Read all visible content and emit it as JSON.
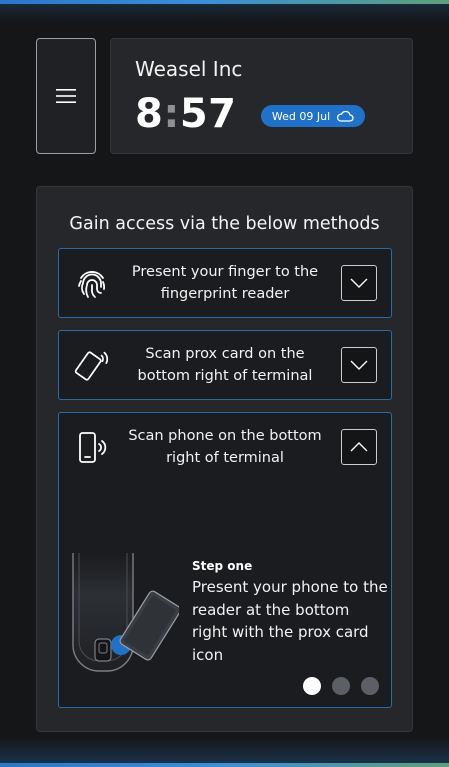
{
  "header": {
    "company_name": "Weasel Inc",
    "time_hours": "8",
    "time_separator": ":",
    "time_minutes": "57",
    "date": "Wed 09 Jul",
    "weather_icon": "cloud-icon"
  },
  "menu": {
    "icon": "hamburger-menu-icon"
  },
  "access": {
    "title": "Gain access via the below methods",
    "methods": [
      {
        "icon": "fingerprint-icon",
        "label": "Present your finger to the fingerprint reader",
        "expanded": false,
        "toggle_icon": "chevron-down-icon"
      },
      {
        "icon": "prox-card-icon",
        "label": "Scan prox card on the bottom right of terminal",
        "expanded": false,
        "toggle_icon": "chevron-down-icon"
      },
      {
        "icon": "phone-nfc-icon",
        "label": "Scan phone on the bottom right of terminal",
        "expanded": true,
        "toggle_icon": "chevron-up-icon",
        "step": {
          "heading": "Step one",
          "text": "Present your phone to the reader at the bottom right with the prox card icon",
          "current_step": 1,
          "total_steps": 3
        }
      }
    ]
  },
  "colors": {
    "background": "#151617",
    "card": "#25272b",
    "accent_blue": "#1f72c8",
    "method_border": "#2c6aa6",
    "active_dot": "#ffffff",
    "inactive_dot": "#5c6066"
  }
}
